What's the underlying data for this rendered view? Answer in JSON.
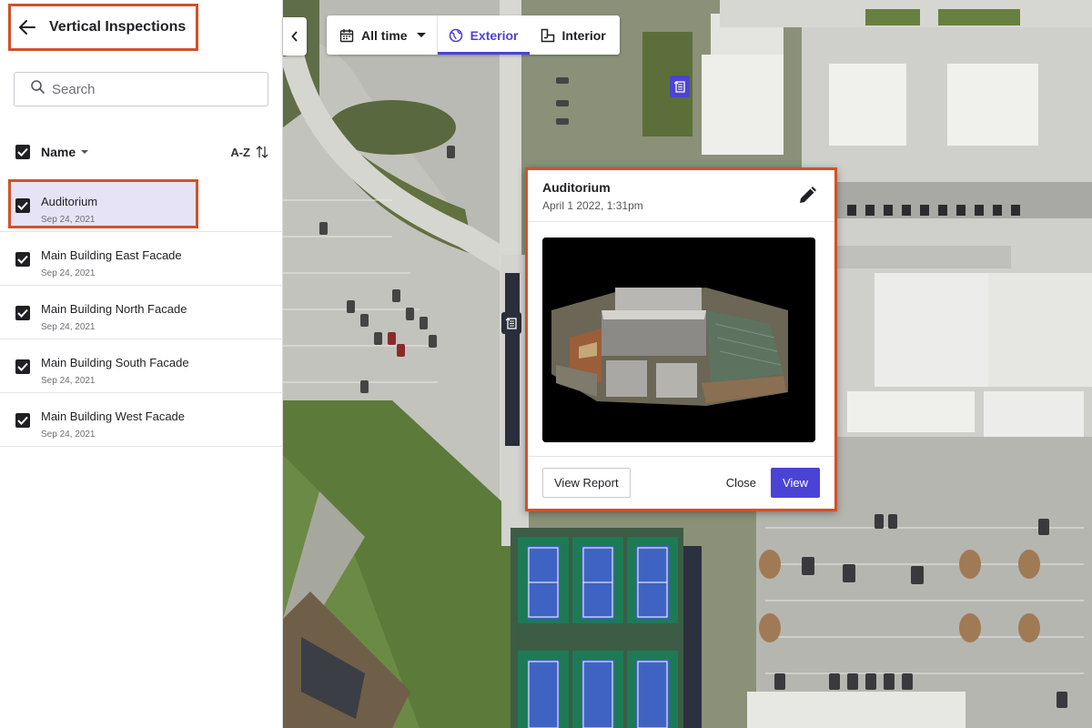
{
  "sidebar": {
    "title": "Vertical Inspections",
    "search_placeholder": "Search",
    "sort_label": "Name",
    "order_label": "A-Z",
    "items": [
      {
        "name": "Auditorium",
        "date": "Sep 24, 2021",
        "checked": true,
        "active": true
      },
      {
        "name": "Main Building East Facade",
        "date": "Sep 24, 2021",
        "checked": true
      },
      {
        "name": "Main Building North Facade",
        "date": "Sep 24, 2021",
        "checked": true
      },
      {
        "name": "Main Building South Facade",
        "date": "Sep 24, 2021",
        "checked": true
      },
      {
        "name": "Main Building West Facade",
        "date": "Sep 24, 2021",
        "checked": true
      }
    ]
  },
  "toolbar": {
    "time_filter": "All time",
    "tab_exterior": "Exterior",
    "tab_interior": "Interior",
    "active_tab": "Exterior"
  },
  "popup": {
    "title": "Auditorium",
    "date": "April 1 2022, 1:31pm",
    "view_report": "View Report",
    "close": "Close",
    "view": "View"
  },
  "colors": {
    "accent": "#4b43d6",
    "highlight_border": "#d0522a",
    "active_row": "#e6e3f6"
  },
  "icons": [
    "back-arrow-icon",
    "search-icon",
    "sort-icon",
    "calendar-icon",
    "globe-icon",
    "floorplan-icon",
    "chevron-left-icon",
    "edit-pencil-icon",
    "building-marker-icon"
  ]
}
